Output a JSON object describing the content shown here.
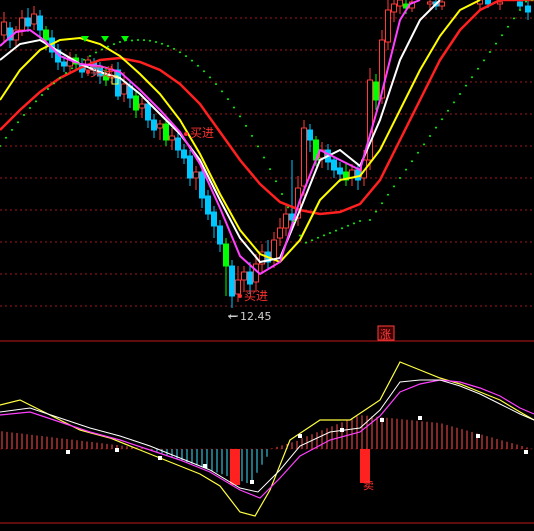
{
  "chart_data": [
    {
      "type": "candlestick",
      "panel": "price",
      "colors": {
        "up": "#ff3b3b",
        "down": "#00c8ff",
        "down_alt": "#00ff00",
        "ma_white": "#ffffff",
        "ma_magenta": "#ff40ff",
        "ma_yellow": "#ffff00",
        "ma_red": "#ff2020",
        "dots": "#00ff00",
        "grid": "#a01818"
      },
      "annotations": {
        "low_label": "12.45",
        "buy_labels": [
          "买进",
          "买进",
          "买进"
        ],
        "sell_label": "卖",
        "zhang_label": "涨"
      }
    },
    {
      "type": "macd",
      "panel": "indicator",
      "colors": {
        "pos": "#ff5050",
        "neg": "#40e0ff",
        "diff": "#ffff40",
        "dea": "#ff40ff",
        "dif_white": "#ffffff"
      },
      "annotations": {
        "sell_label": "卖"
      }
    }
  ]
}
